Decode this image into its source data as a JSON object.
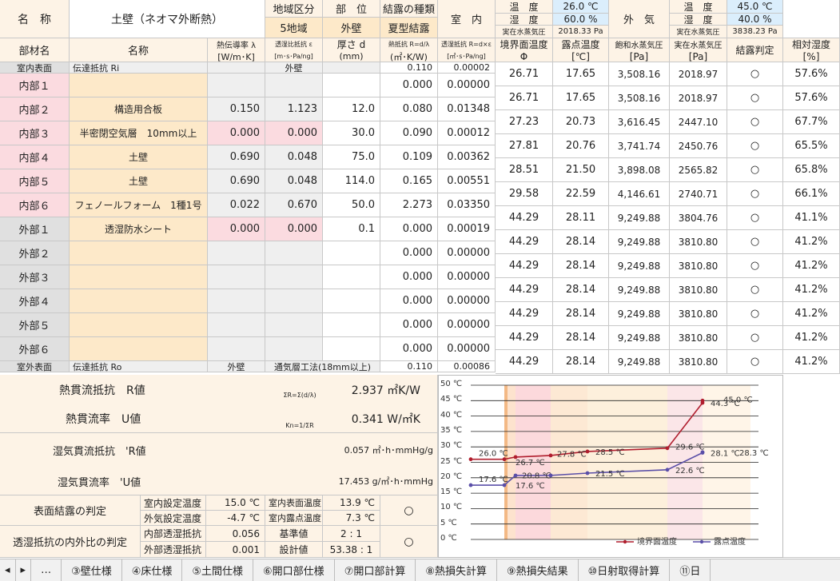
{
  "header": {
    "name_label": "名　称",
    "name_value": "土壁（ネオマ外断熱）",
    "region_label": "地域区分",
    "region_value": "5地域",
    "part_label": "部　位",
    "part_value": "外壁",
    "cond_label": "結露の種類",
    "cond_value": "夏型結露",
    "indoor_label": "室　内",
    "in_temp_label": "温　度",
    "in_temp_value": "26.0 ℃",
    "in_hum_label": "湿　度",
    "in_hum_value": "60.0 %",
    "in_vp_label": "実在水蒸気圧",
    "in_vp_value": "2018.33 Pa",
    "outdoor_label": "外　気",
    "out_temp_label": "温　度",
    "out_temp_value": "45.0 ℃",
    "out_hum_label": "湿　度",
    "out_hum_value": "40.0 %",
    "out_vp_label": "実在水蒸気圧",
    "out_vp_value": "3838.23 Pa"
  },
  "columns": {
    "material": "部材名",
    "name": "名称",
    "lambda": "熱伝導率 λ",
    "lambda_unit": "[W/m･K]",
    "perm": "透湿比抵抗 ε",
    "perm_unit": "[m･s･Pa/ng]",
    "thick": "厚さ d",
    "thick_unit": "(mm)",
    "rth": "熱抵抗 R=d/λ",
    "rth_unit": "(㎡･K/W)",
    "rv": "透湿抵抗 R=d×ε",
    "rv_unit": "[㎡･s･Pa/ng]",
    "boundary": "境界面温度",
    "boundary_unit": "Φ",
    "dew": "露点温度",
    "dew_unit": "[℃]",
    "sat": "飽和水蒸気圧",
    "sat_unit": "[Pa]",
    "vp": "実在水蒸気圧",
    "vp_unit": "[Pa]",
    "judge": "結露判定",
    "rh": "相対湿度",
    "rh_unit": "[%]"
  },
  "rows": [
    {
      "mat": "室内表面",
      "name": "伝達抵抗 Ri",
      "lam": "",
      "perm": "外壁",
      "thk": "",
      "r": "0.110",
      "rv": "0.00002"
    },
    {
      "mat": "内部１",
      "name": "",
      "lam": "",
      "perm": "",
      "thk": "",
      "r": "0.000",
      "rv": "0.00000"
    },
    {
      "mat": "内部２",
      "name": "構造用合板",
      "lam": "0.150",
      "perm": "1.123",
      "thk": "12.0",
      "r": "0.080",
      "rv": "0.01348"
    },
    {
      "mat": "内部３",
      "name": "半密閉空気層　10mm以上",
      "lam": "0.000",
      "perm": "0.000",
      "thk": "30.0",
      "r": "0.090",
      "rv": "0.00012"
    },
    {
      "mat": "内部４",
      "name": "土壁",
      "lam": "0.690",
      "perm": "0.048",
      "thk": "75.0",
      "r": "0.109",
      "rv": "0.00362"
    },
    {
      "mat": "内部５",
      "name": "土壁",
      "lam": "0.690",
      "perm": "0.048",
      "thk": "114.0",
      "r": "0.165",
      "rv": "0.00551"
    },
    {
      "mat": "内部６",
      "name": "フェノールフォーム　1種1号",
      "lam": "0.022",
      "perm": "0.670",
      "thk": "50.0",
      "r": "2.273",
      "rv": "0.03350"
    },
    {
      "mat": "外部１",
      "name": "透湿防水シート",
      "lam": "0.000",
      "perm": "0.000",
      "thk": "0.1",
      "r": "0.000",
      "rv": "0.00019"
    },
    {
      "mat": "外部２",
      "name": "",
      "lam": "",
      "perm": "",
      "thk": "",
      "r": "0.000",
      "rv": "0.00000"
    },
    {
      "mat": "外部３",
      "name": "",
      "lam": "",
      "perm": "",
      "thk": "",
      "r": "0.000",
      "rv": "0.00000"
    },
    {
      "mat": "外部４",
      "name": "",
      "lam": "",
      "perm": "",
      "thk": "",
      "r": "0.000",
      "rv": "0.00000"
    },
    {
      "mat": "外部５",
      "name": "",
      "lam": "",
      "perm": "",
      "thk": "",
      "r": "0.000",
      "rv": "0.00000"
    },
    {
      "mat": "外部６",
      "name": "",
      "lam": "",
      "perm": "",
      "thk": "",
      "r": "0.000",
      "rv": "0.00000"
    },
    {
      "mat": "室外表面",
      "name": "伝達抵抗 Ro",
      "lam": "外壁",
      "perm": "通気層工法(18mm以上)",
      "thk": "",
      "r": "0.110",
      "rv": "0.00086"
    }
  ],
  "results": [
    {
      "bt": "26.71",
      "dew": "17.65",
      "sat": "3,508.16",
      "vp": "2018.97",
      "j": "○",
      "rh": "57.6%"
    },
    {
      "bt": "26.71",
      "dew": "17.65",
      "sat": "3,508.16",
      "vp": "2018.97",
      "j": "○",
      "rh": "57.6%"
    },
    {
      "bt": "27.23",
      "dew": "20.73",
      "sat": "3,616.45",
      "vp": "2447.10",
      "j": "○",
      "rh": "67.7%"
    },
    {
      "bt": "27.81",
      "dew": "20.76",
      "sat": "3,741.74",
      "vp": "2450.76",
      "j": "○",
      "rh": "65.5%"
    },
    {
      "bt": "28.51",
      "dew": "21.50",
      "sat": "3,898.08",
      "vp": "2565.82",
      "j": "○",
      "rh": "65.8%"
    },
    {
      "bt": "29.58",
      "dew": "22.59",
      "sat": "4,146.61",
      "vp": "2740.71",
      "j": "○",
      "rh": "66.1%"
    },
    {
      "bt": "44.29",
      "dew": "28.11",
      "sat": "9,249.88",
      "vp": "3804.76",
      "j": "○",
      "rh": "41.1%"
    },
    {
      "bt": "44.29",
      "dew": "28.14",
      "sat": "9,249.88",
      "vp": "3810.80",
      "j": "○",
      "rh": "41.2%"
    },
    {
      "bt": "44.29",
      "dew": "28.14",
      "sat": "9,249.88",
      "vp": "3810.80",
      "j": "○",
      "rh": "41.2%"
    },
    {
      "bt": "44.29",
      "dew": "28.14",
      "sat": "9,249.88",
      "vp": "3810.80",
      "j": "○",
      "rh": "41.2%"
    },
    {
      "bt": "44.29",
      "dew": "28.14",
      "sat": "9,249.88",
      "vp": "3810.80",
      "j": "○",
      "rh": "41.2%"
    },
    {
      "bt": "44.29",
      "dew": "28.14",
      "sat": "9,249.88",
      "vp": "3810.80",
      "j": "○",
      "rh": "41.2%"
    },
    {
      "bt": "44.29",
      "dew": "28.14",
      "sat": "9,249.88",
      "vp": "3810.80",
      "j": "○",
      "rh": "41.2%"
    }
  ],
  "summary": {
    "thermal_r_label": "熱貫流抵抗　R値",
    "thermal_r_formula": "ΣR=Σ(d/λ)",
    "thermal_r_value": "2.937 ㎡K/W",
    "u_label": "熱貫流率　U値",
    "u_formula": "Kn=1/ΣR",
    "u_value": "0.341 W/㎡K",
    "moist_r_label": "湿気貫流抵抗　'R値",
    "moist_r_value": "0.057 ㎡･h･mmHg/g",
    "moist_u_label": "湿気貫流率　'U値",
    "moist_u_value": "17.453 g/㎡･h･mmHg",
    "surface_label": "表面結露の判定",
    "in_set_label": "室内設定温度",
    "in_set_value": "15.0 ℃",
    "out_set_label": "外気設定温度",
    "out_set_value": "-4.7 ℃",
    "in_surf_label": "室内表面温度",
    "in_surf_value": "13.9 ℃",
    "in_dew_label": "室内露点温度",
    "in_dew_value": "7.3 ℃",
    "surface_judge": "○",
    "ratio_label": "透湿抵抗の内外比の判定",
    "in_perm_label": "内部透湿抵抗",
    "in_perm_value": "0.056",
    "out_perm_label": "外部透湿抵抗",
    "out_perm_value": "0.001",
    "std_label": "基準値",
    "std_value": "2 : 1",
    "design_label": "設計値",
    "design_value": "53.38 : 1",
    "ratio_judge": "○"
  },
  "chart_data": {
    "type": "line",
    "ylim": [
      0,
      50
    ],
    "yticks": [
      "0 ℃",
      "5 ℃",
      "10 ℃",
      "15 ℃",
      "20 ℃",
      "25 ℃",
      "30 ℃",
      "35 ℃",
      "40 ℃",
      "45 ℃",
      "50 ℃"
    ],
    "colors": {
      "boundary": "#b01e2e",
      "dew": "#5a4fa8"
    },
    "series": [
      {
        "name": "境界面温度",
        "x": [
          0,
          1,
          2,
          3,
          4,
          5,
          6,
          7
        ],
        "values": [
          26.0,
          26.0,
          26.71,
          27.23,
          28.51,
          29.58,
          44.29,
          45.0
        ]
      },
      {
        "name": "露点温度",
        "x": [
          0,
          1,
          2,
          3,
          4,
          5,
          6,
          7
        ],
        "values": [
          17.6,
          17.6,
          20.73,
          20.76,
          21.5,
          22.59,
          28.11,
          28.3
        ]
      }
    ],
    "labels": {
      "b_left": "26.0 ℃",
      "b_mid1": "26.7 ℃",
      "b_mid2": "27.8 ℃",
      "b_mid3": "28.5 ℃",
      "b_mid4": "29.6 ℃",
      "b_top": "44.3 ℃",
      "b_right": "45.0 ℃",
      "d_left": "17.6 ℃",
      "d_mid1": "17.6 ℃",
      "d_mid2": "20.8 ℃",
      "d_mid3": "21.5 ℃",
      "d_mid4": "22.6 ℃",
      "d_top": "28.1 ℃",
      "d_right": "28.3 ℃"
    }
  },
  "tabs": {
    "nav": "…",
    "t1": "③壁仕様",
    "t2": "④床仕様",
    "t3": "⑤土間仕様",
    "t4": "⑥開口部仕様",
    "t5": "⑦開口部計算",
    "t6": "⑧熱損失計算",
    "t7": "⑨熱損失結果",
    "t8": "⑩日射取得計算",
    "t9": "⑪日"
  }
}
